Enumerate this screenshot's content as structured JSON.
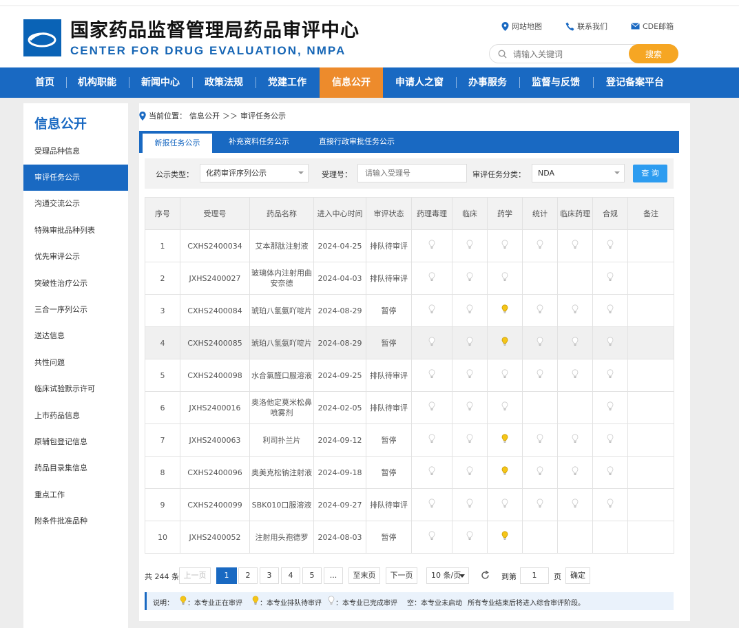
{
  "header": {
    "title_cn": "国家药品监督管理局药品审评中心",
    "title_en": "CENTER FOR DRUG EVALUATION, NMPA",
    "links": {
      "sitemap": "网站地图",
      "contact": "联系我们",
      "mail": "CDE邮箱"
    },
    "search": {
      "placeholder": "请输入关键词",
      "button": "搜索"
    }
  },
  "nav": [
    "首页",
    "机构职能",
    "新闻中心",
    "政策法规",
    "党建工作",
    "信息公开",
    "申请人之窗",
    "办事服务",
    "监督与反馈",
    "登记备案平台"
  ],
  "sidebar": {
    "title": "信息公开",
    "items": [
      "受理品种信息",
      "审评任务公示",
      "沟通交流公示",
      "特殊审批品种列表",
      "优先审评公示",
      "突破性治疗公示",
      "三合一序列公示",
      "送达信息",
      "共性问题",
      "临床试验默示许可",
      "上市药品信息",
      "原辅包登记信息",
      "药品目录集信息",
      "重点工作",
      "附条件批准品种"
    ]
  },
  "breadcrumb": {
    "prefix": "当前位置：",
    "path": "信息公开",
    "sep": "＞＞",
    "current": "审评任务公示"
  },
  "tabs": [
    "新报任务公示",
    "补充资料任务公示",
    "直接行政审批任务公示"
  ],
  "filter": {
    "type_label": "公示类型：",
    "type_value": "化药审评序列公示",
    "accept_label": "受理号：",
    "accept_placeholder": "请输入受理号",
    "cat_label": "审评任务分类：",
    "cat_value": "NDA",
    "query": "查 询"
  },
  "table": {
    "headers": [
      "序号",
      "受理号",
      "药品名称",
      "进入中心时间",
      "审评状态",
      "药理毒理",
      "临床",
      "药学",
      "统计",
      "临床药理",
      "合规",
      "备注"
    ],
    "rows": [
      [
        "1",
        "CXHS2400034",
        "艾本那肽注射液",
        "2024-04-25",
        "排队待审评"
      ],
      [
        "2",
        "JXHS2400027",
        "玻璃体内注射用曲安奈德",
        "2024-04-03",
        "排队待审评"
      ],
      [
        "3",
        "CXHS2400084",
        "琥珀八氢氨吖啶片",
        "2024-08-29",
        "暂停"
      ],
      [
        "4",
        "CXHS2400085",
        "琥珀八氢氨吖啶片",
        "2024-08-29",
        "暂停"
      ],
      [
        "5",
        "CXHS2400098",
        "水合氯醛口服溶液",
        "2024-09-25",
        "排队待审评"
      ],
      [
        "6",
        "JXHS2400016",
        "奥洛他定莫米松鼻喷雾剂",
        "2024-02-05",
        "排队待审评"
      ],
      [
        "7",
        "JXHS2400063",
        "利司扑兰片",
        "2024-09-12",
        "暂停"
      ],
      [
        "8",
        "CXHS2400096",
        "奥美克松钠注射液",
        "2024-09-18",
        "暂停"
      ],
      [
        "9",
        "CXHS2400099",
        "SBK010口服溶液",
        "2024-09-27",
        "排队待审评"
      ],
      [
        "10",
        "JXHS2400052",
        "注射用头孢德罗",
        "2024-08-03",
        "暂停"
      ]
    ],
    "bulbs": [
      [
        "done",
        "done",
        "done",
        "done",
        "done",
        "done"
      ],
      [
        "done",
        "done",
        "done",
        "",
        "",
        "done"
      ],
      [
        "done",
        "done",
        "active",
        "done",
        "done",
        "done"
      ],
      [
        "done",
        "done",
        "active",
        "done",
        "done",
        "done"
      ],
      [
        "done",
        "done",
        "done",
        "done",
        "done",
        "done"
      ],
      [
        "done",
        "done",
        "done",
        "",
        "",
        "done"
      ],
      [
        "done",
        "done",
        "active",
        "done",
        "done",
        "done"
      ],
      [
        "done",
        "done",
        "active",
        "done",
        "done",
        "done"
      ],
      [
        "done",
        "done",
        "done",
        "done",
        "done",
        "done"
      ],
      [
        "done",
        "done",
        "active",
        "",
        "",
        ""
      ]
    ]
  },
  "pager": {
    "total": "共 244 条",
    "prev": "上一页",
    "pages": [
      "1",
      "2",
      "3",
      "4",
      "5",
      "..."
    ],
    "last": "至末页",
    "next": "下一页",
    "size": "10 条/页",
    "goto": "到第",
    "page_value": "1",
    "page_unit": "页",
    "confirm": "确定"
  },
  "legend": {
    "label": "说明：",
    "in_review": "：本专业正在审评",
    "queued": "：本专业排队待审评",
    "done": "：本专业已完成审评",
    "empty": "空：本专业未启动",
    "note": "所有专业结束后将进入综合审评阶段。"
  },
  "colors": {
    "brand": "#1969c2",
    "active_nav": "#ed8b2c",
    "search_btn": "#f6a623",
    "bulb_active": "#f5c518",
    "bulb_done": "#c8c8c8"
  }
}
